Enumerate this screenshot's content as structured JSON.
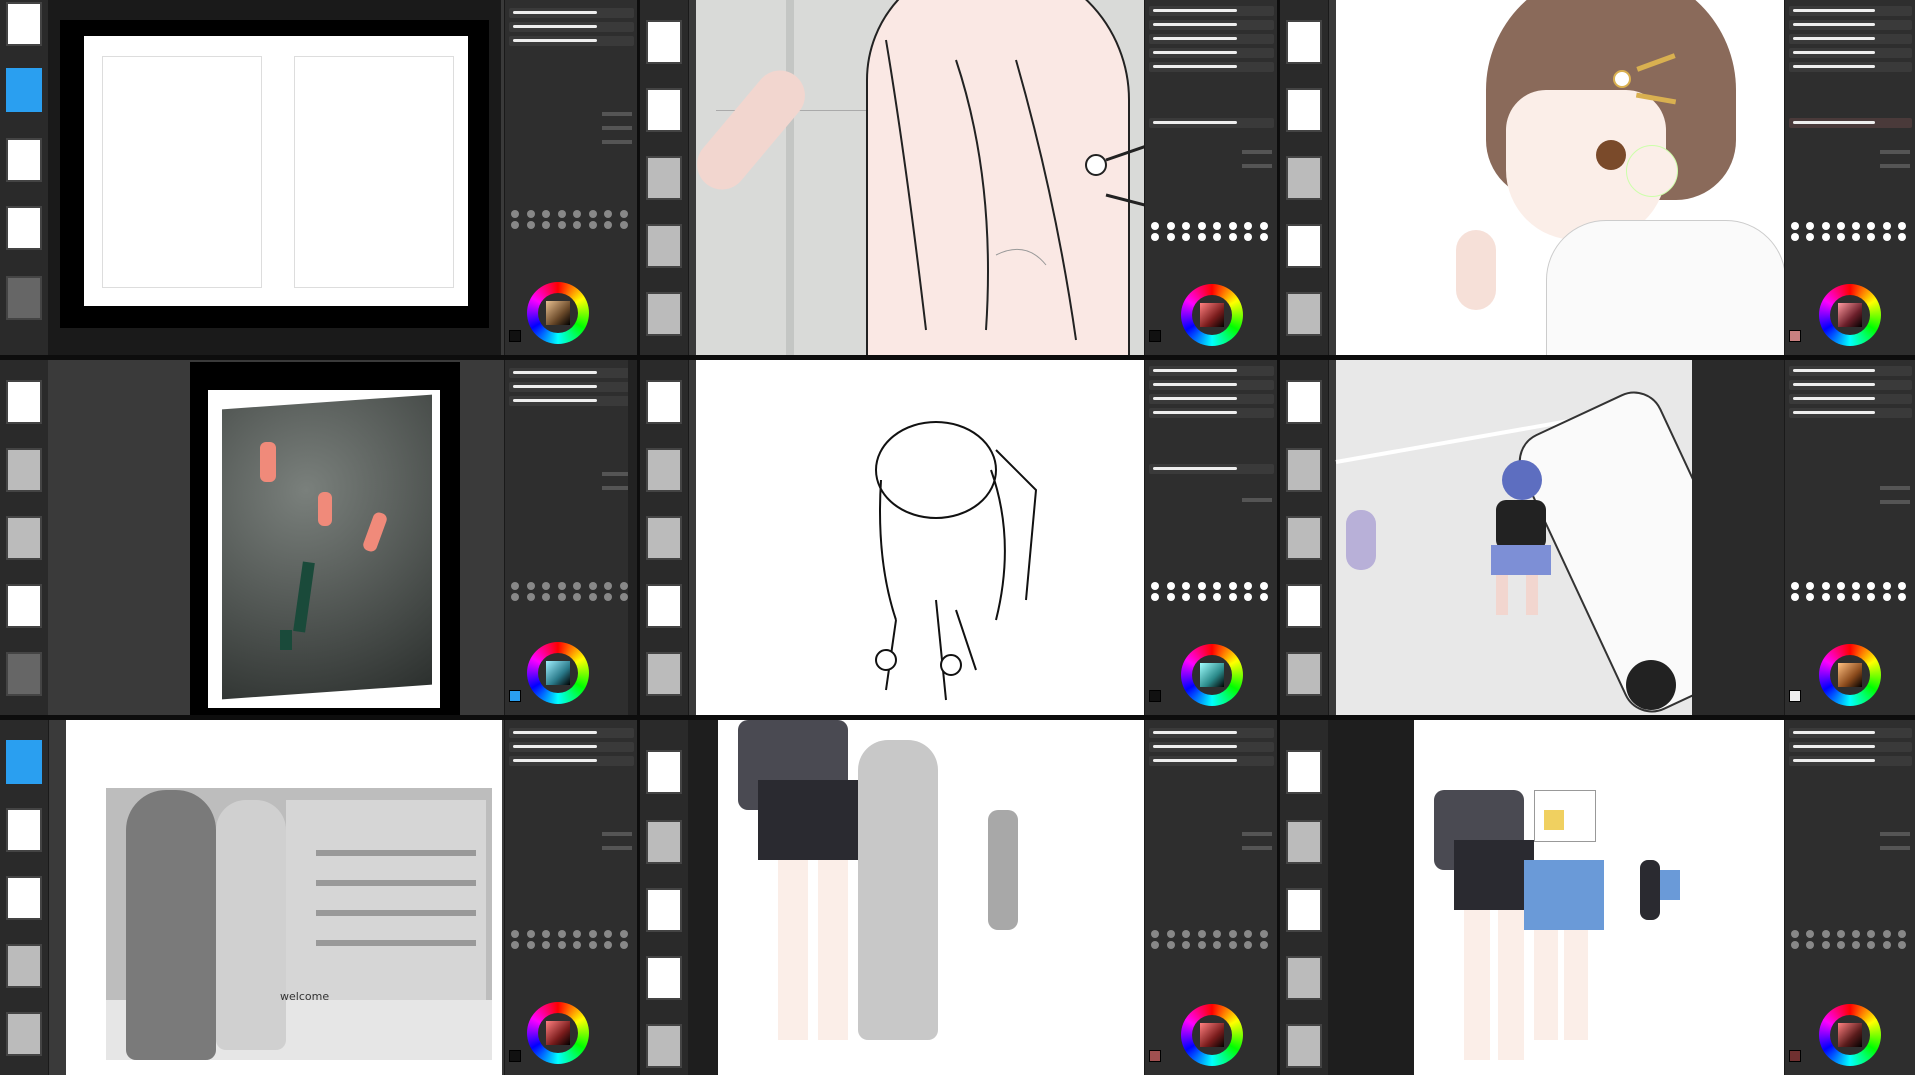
{
  "app": {
    "panel_label_icon": "clip-studio-style-workspace",
    "colors": {
      "bg": "#0d0d0d",
      "accent": "#2a9ff0",
      "panel": "#2e2e2e"
    }
  },
  "panels": [
    {
      "id": "p1",
      "canvas_kind": "blank-two-page-spread",
      "wheel_center": "#6b4a2a"
    },
    {
      "id": "p2",
      "canvas_kind": "girl-lineart-closeup-pink",
      "wheel_center": "#7a1c1c"
    },
    {
      "id": "p3",
      "canvas_kind": "girl-colored-bust",
      "wheel_center": "#6b1f2a"
    },
    {
      "id": "p4",
      "canvas_kind": "3d-pose-figures",
      "wheel_center": "#2a7a8a"
    },
    {
      "id": "p5",
      "canvas_kind": "figure-lineart-bending",
      "wheel_center": "#2b8a8a"
    },
    {
      "id": "p6",
      "canvas_kind": "girl-pushing-car",
      "wheel_center": "#8a4a1c"
    },
    {
      "id": "p7",
      "canvas_kind": "store-front-grayscale",
      "wheel_center": "#7a1c1c"
    },
    {
      "id": "p8",
      "canvas_kind": "students-walking-partial-color",
      "wheel_center": "#7a1c1c"
    },
    {
      "id": "p9",
      "canvas_kind": "students-walking-colored",
      "wheel_center": "#5a1c1c"
    }
  ],
  "store_sign_text": "welcome"
}
